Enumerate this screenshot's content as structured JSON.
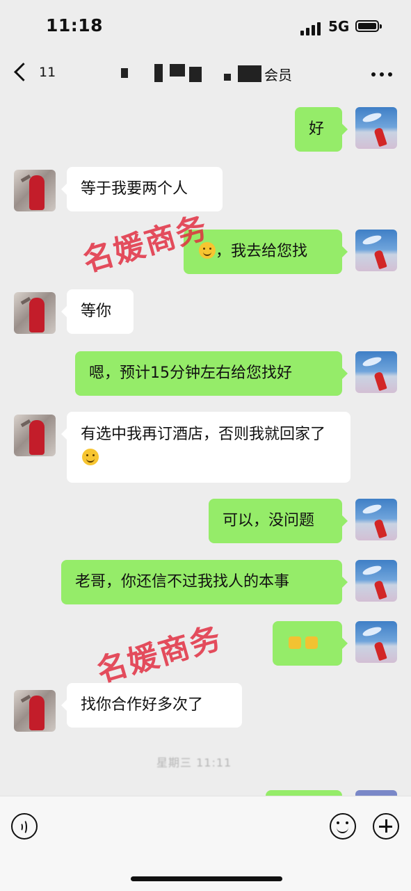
{
  "status_bar": {
    "time": "11:18",
    "network": "5G"
  },
  "nav": {
    "back_count": "11",
    "title_visible_suffix": "会员",
    "title_redacted": true
  },
  "messages": [
    {
      "from": "me",
      "text": "好"
    },
    {
      "from": "peer",
      "text": "等于我要两个人"
    },
    {
      "from": "me",
      "emoji": "smile-emoji",
      "text": "，我去给您找"
    },
    {
      "from": "peer",
      "text": "等你"
    },
    {
      "from": "me",
      "text": "嗯，预计15分钟左右给您找好"
    },
    {
      "from": "peer",
      "text": "有选中我再订酒店，否则我就回家了",
      "emoji": "grin-emoji"
    },
    {
      "from": "me",
      "text": "可以，没问题"
    },
    {
      "from": "me",
      "text": "老哥，你还信不过我找人的本事"
    },
    {
      "from": "me",
      "emoji": "double-emoji"
    },
    {
      "from": "peer",
      "text": "找你合作好多次了"
    }
  ],
  "timestamp": "星期三 11:11",
  "watermark": "名媛商务",
  "input_bar": {
    "placeholder": ""
  },
  "icons": [
    "back-chevron-icon",
    "more-icon",
    "voice-icon",
    "emoji-icon",
    "plus-icon"
  ],
  "colors": {
    "my_bubble": "#95ec69",
    "peer_bubble": "#ffffff",
    "background": "#ededed",
    "watermark": "#e1283c"
  }
}
